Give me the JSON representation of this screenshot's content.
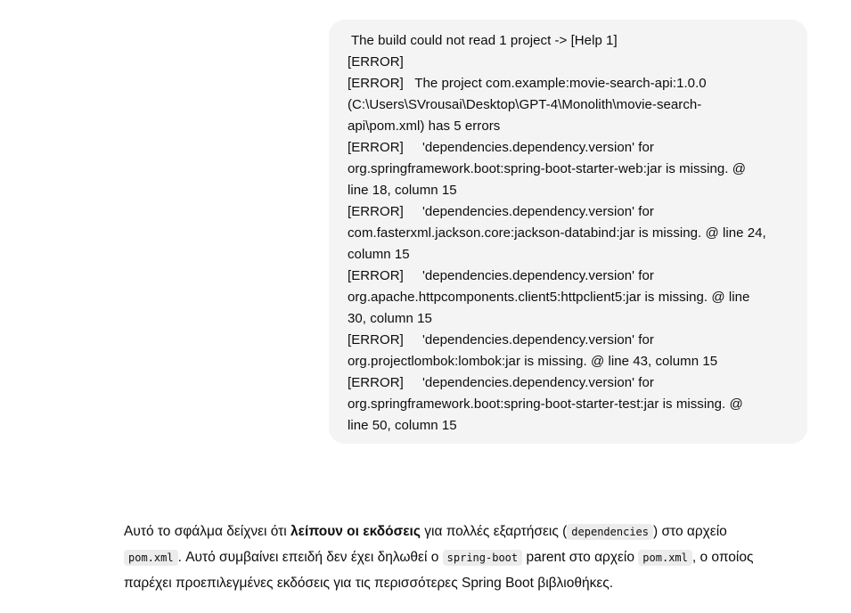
{
  "user_message": {
    "lines": [
      " The build could not read 1 project -> [Help 1]",
      "[ERROR]",
      "[ERROR]   The project com.example:movie-search-api:1.0.0",
      "(C:\\Users\\SVrousai\\Desktop\\GPT-4\\Monolith\\movie-search-",
      "api\\pom.xml) has 5 errors",
      "[ERROR]     'dependencies.dependency.version' for",
      "org.springframework.boot:spring-boot-starter-web:jar is missing. @",
      "line 18, column 15",
      "[ERROR]     'dependencies.dependency.version' for",
      "com.fasterxml.jackson.core:jackson-databind:jar is missing. @ line 24,",
      "column 15",
      "[ERROR]     'dependencies.dependency.version' for",
      "org.apache.httpcomponents.client5:httpclient5:jar is missing. @ line",
      "30, column 15",
      "[ERROR]     'dependencies.dependency.version' for",
      "org.projectlombok:lombok:jar is missing. @ line 43, column 15",
      "[ERROR]     'dependencies.dependency.version' for",
      "org.springframework.boot:spring-boot-starter-test:jar is missing. @",
      "line 50, column 15"
    ]
  },
  "assistant_message": {
    "p1_before": "Αυτό το σφάλμα δείχνει ότι ",
    "p1_bold": "λείπουν οι εκδόσεις",
    "p1_mid": " για πολλές εξαρτήσεις (",
    "code_dependencies": "dependencies",
    "p1_after": ") στο αρχείο",
    "code_pom1": "pom.xml",
    "p2_mid": ". Αυτό συμβαίνει επειδή δεν έχει δηλωθεί ο ",
    "code_spring_boot": "spring-boot",
    "p2_mid2": " parent στο αρχείο ",
    "code_pom2": "pom.xml",
    "p2_after": ", ο οποίος",
    "p3": "παρέχει προεπιλεγμένες εκδόσεις για τις περισσότερες Spring Boot βιβλιοθήκες."
  }
}
